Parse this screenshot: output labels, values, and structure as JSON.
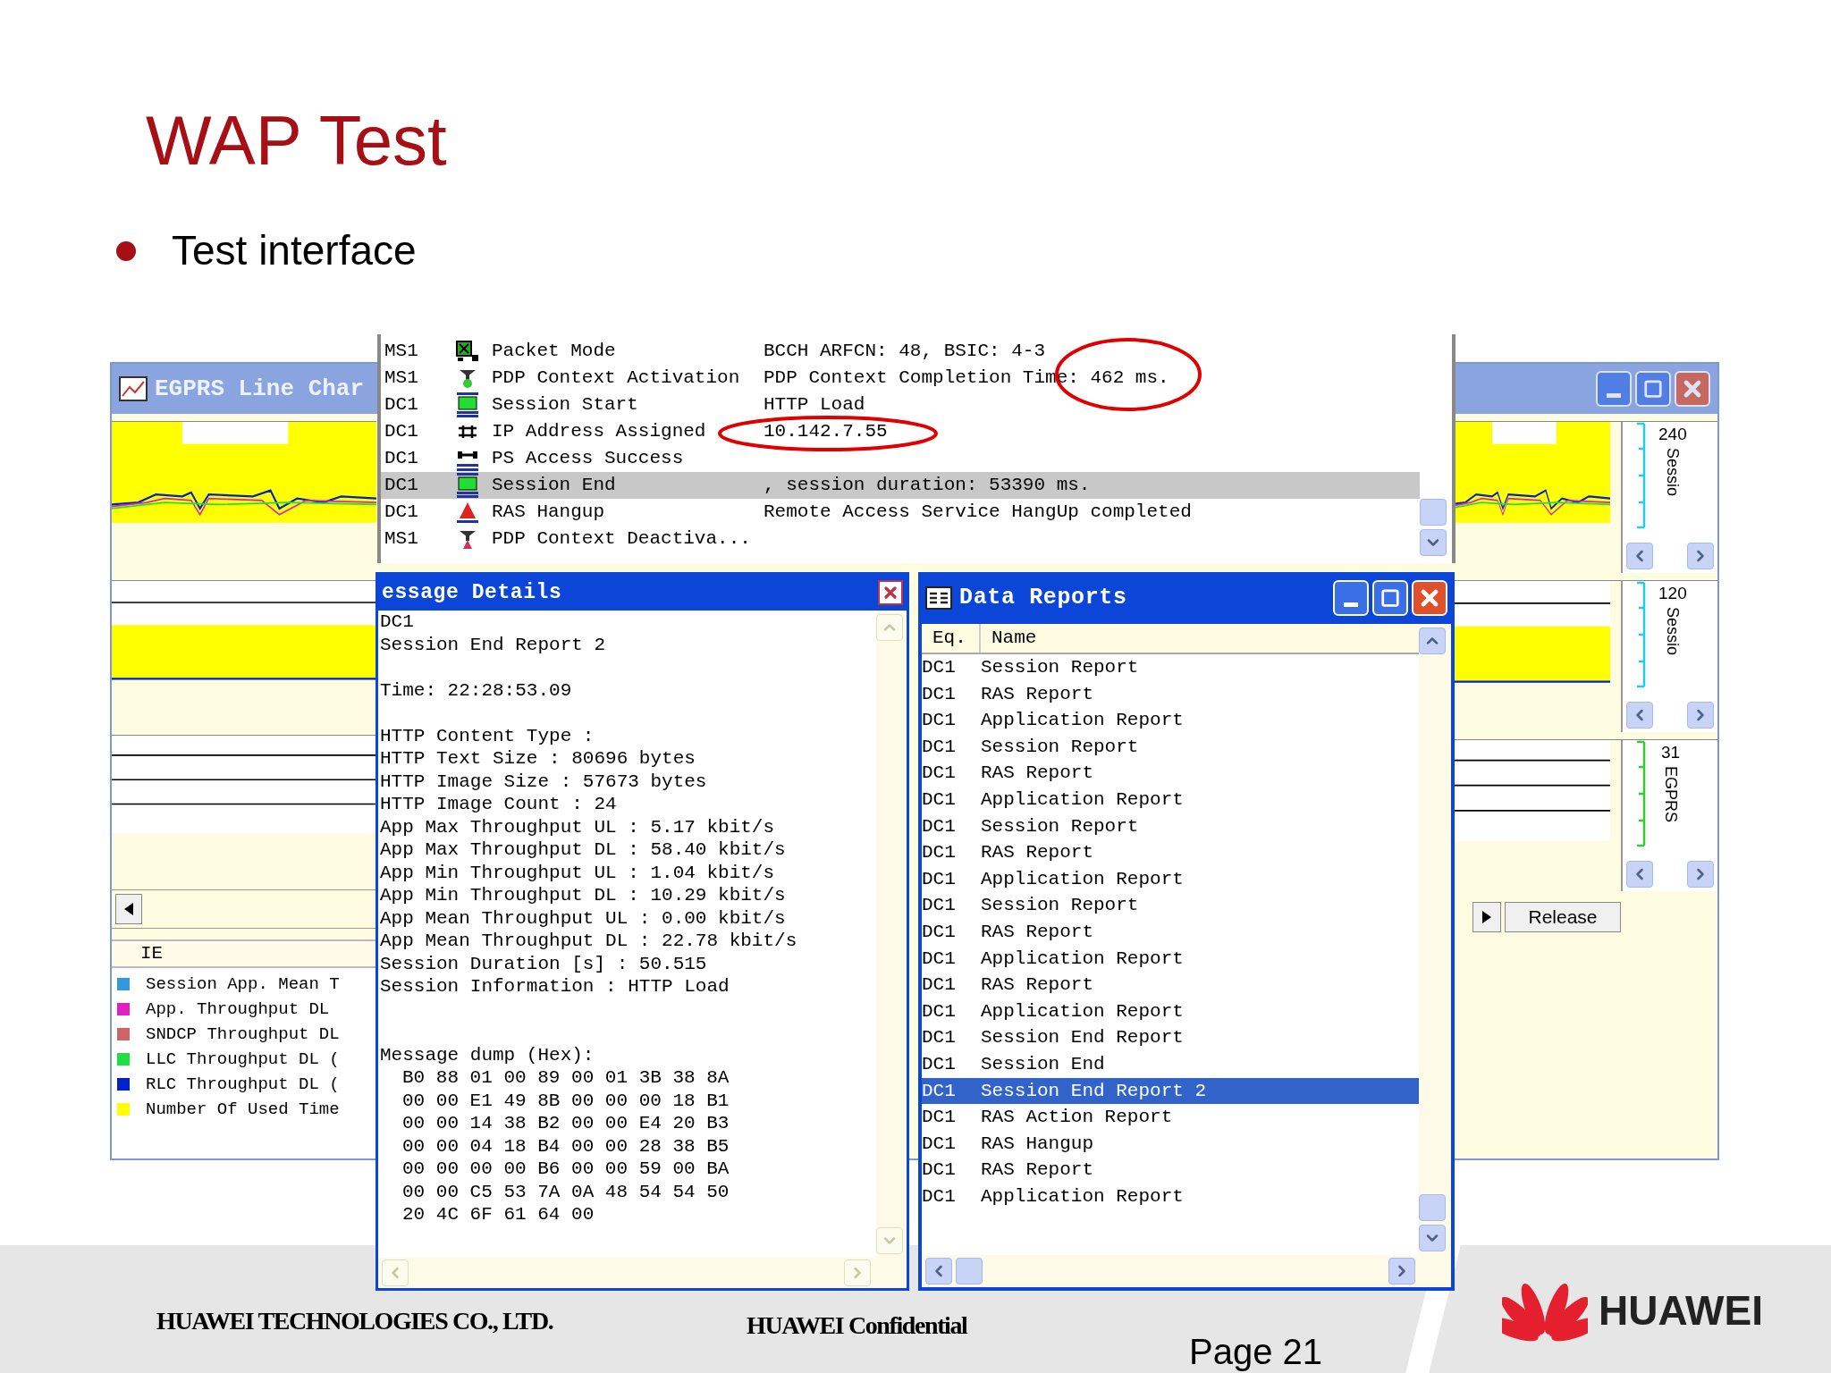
{
  "slide": {
    "title": "WAP Test",
    "bullets": [
      "Test interface"
    ]
  },
  "line_chart_window": {
    "title": "EGPRS Line Char",
    "legend_header": "IE",
    "legend": [
      {
        "label": "Session App. Mean T",
        "color": "#3399dd"
      },
      {
        "label": "App. Throughput DL",
        "color": "#e020c0"
      },
      {
        "label": "SNDCP Throughput DL",
        "color": "#cc6666"
      },
      {
        "label": "LLC Throughput DL (",
        "color": "#22dd44"
      },
      {
        "label": "RLC Throughput DL (",
        "color": "#0022cc"
      },
      {
        "label": "Number Of Used Time",
        "color": "#ffff00"
      }
    ],
    "axes": [
      {
        "max": "240",
        "label": "Sessio",
        "color": "#22ccee"
      },
      {
        "max": "120",
        "label": "Sessio",
        "color": "#22ccee"
      },
      {
        "max": "31",
        "label": "EGPRS",
        "color": "#33cc33"
      }
    ],
    "release_button": "Release"
  },
  "event_log": {
    "rows": [
      {
        "eq": "MS1",
        "kind": "packet",
        "event": "Packet Mode",
        "detail": "BCCH ARFCN: 48, BSIC: 4-3",
        "selected": false
      },
      {
        "eq": "MS1",
        "kind": "pdp",
        "event": "PDP Context Activation",
        "detail": "PDP Context Completion Time: 462 ms.",
        "selected": false
      },
      {
        "eq": "DC1",
        "kind": "session",
        "event": "Session Start",
        "detail": "HTTP Load",
        "selected": false
      },
      {
        "eq": "DC1",
        "kind": "ip",
        "event": "IP Address Assigned",
        "detail": "10.142.7.55",
        "selected": false
      },
      {
        "eq": "DC1",
        "kind": "access",
        "event": "PS Access Success",
        "selected": false
      },
      {
        "eq": "DC1",
        "kind": "session",
        "event": "Session End",
        "detail": ", session duration: 53390 ms.",
        "selected": true
      },
      {
        "eq": "DC1",
        "kind": "ras",
        "event": "RAS Hangup",
        "detail": "Remote Access Service HangUp completed",
        "selected": false
      },
      {
        "eq": "MS1",
        "kind": "pdp_off",
        "event": "PDP Context Deactiva...",
        "selected": false
      }
    ]
  },
  "message_details": {
    "title": "essage Details",
    "sections": [
      {
        "kind": "text",
        "lines": [
          "DC1",
          "Session End Report 2"
        ]
      },
      {
        "kind": "text",
        "lines": [
          "Time: 22:28:53.09"
        ]
      },
      {
        "kind": "text",
        "lines": [
          "HTTP Content Type :",
          "HTTP Text Size : 80696 bytes",
          "HTTP Image Size : 57673 bytes",
          "HTTP Image Count : 24",
          "App Max Throughput UL : 5.17 kbit/s",
          "App Max Throughput DL : 58.40 kbit/s",
          "App Min Throughput UL : 1.04 kbit/s",
          "App Min Throughput DL : 10.29 kbit/s",
          "App Mean Throughput UL : 0.00 kbit/s",
          "App Mean Throughput DL : 22.78 kbit/s",
          "Session Duration [s] : 50.515",
          "Session Information : HTTP Load"
        ]
      },
      {
        "kind": "hex",
        "header": "Message dump (Hex):",
        "lines": [
          "B0 88 01 00 89 00 01 3B 38 8A",
          "00 00 E1 49 8B 00 00 00 18 B1",
          "00 00 14 38 B2 00 00 E4 20 B3",
          "00 00 04 18 B4 00 00 28 38 B5",
          "00 00 00 00 B6 00 00 59 00 BA",
          "00 00 C5 53 7A 0A 48 54 54 50",
          "20 4C 6F 61 64 00"
        ]
      }
    ]
  },
  "data_reports": {
    "title": "Data Reports",
    "columns": [
      "Eq.",
      "Name"
    ],
    "rows": [
      {
        "eq": "DC1",
        "name": "Session Report",
        "selected": false
      },
      {
        "eq": "DC1",
        "name": "RAS Report",
        "selected": false
      },
      {
        "eq": "DC1",
        "name": "Application Report",
        "selected": false
      },
      {
        "eq": "DC1",
        "name": "Session Report",
        "selected": false
      },
      {
        "eq": "DC1",
        "name": "RAS Report",
        "selected": false
      },
      {
        "eq": "DC1",
        "name": "Application Report",
        "selected": false
      },
      {
        "eq": "DC1",
        "name": "Session Report",
        "selected": false
      },
      {
        "eq": "DC1",
        "name": "RAS Report",
        "selected": false
      },
      {
        "eq": "DC1",
        "name": "Application Report",
        "selected": false
      },
      {
        "eq": "DC1",
        "name": "Session Report",
        "selected": false
      },
      {
        "eq": "DC1",
        "name": "RAS Report",
        "selected": false
      },
      {
        "eq": "DC1",
        "name": "Application Report",
        "selected": false
      },
      {
        "eq": "DC1",
        "name": "RAS Report",
        "selected": false
      },
      {
        "eq": "DC1",
        "name": "Application Report",
        "selected": false
      },
      {
        "eq": "DC1",
        "name": "Session End Report",
        "selected": false
      },
      {
        "eq": "DC1",
        "name": "Session End",
        "selected": false
      },
      {
        "eq": "DC1",
        "name": "Session End Report 2",
        "selected": true
      },
      {
        "eq": "DC1",
        "name": "RAS Action Report",
        "selected": false
      },
      {
        "eq": "DC1",
        "name": "RAS Hangup",
        "selected": false
      },
      {
        "eq": "DC1",
        "name": "RAS Report",
        "selected": false
      },
      {
        "eq": "DC1",
        "name": "Application Report",
        "selected": false
      }
    ]
  },
  "footer": {
    "company": "HUAWEI TECHNOLOGIES CO., LTD.",
    "confidential": "HUAWEI Confidential",
    "page": "Page 21",
    "logo_text": "HUAWEI"
  }
}
